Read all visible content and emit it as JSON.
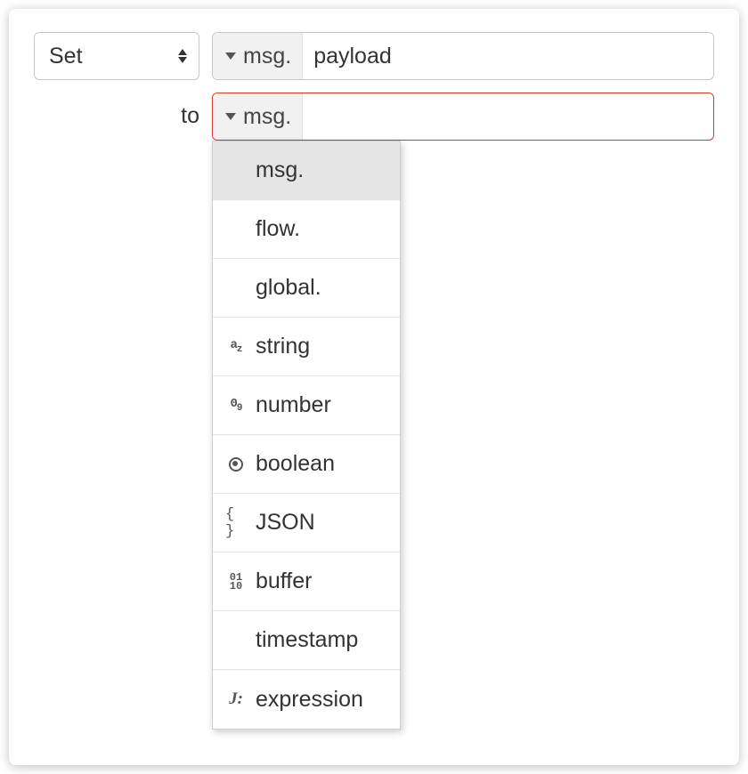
{
  "action_select": {
    "value": "Set"
  },
  "property_input": {
    "type_label": "msg.",
    "value": "payload"
  },
  "to_label": "to",
  "value_input": {
    "type_label": "msg.",
    "value": ""
  },
  "type_dropdown": {
    "options": [
      {
        "label": "msg.",
        "icon": "",
        "selected": true
      },
      {
        "label": "flow.",
        "icon": "",
        "selected": false
      },
      {
        "label": "global.",
        "icon": "",
        "selected": false
      },
      {
        "label": "string",
        "icon": "az",
        "selected": false
      },
      {
        "label": "number",
        "icon": "09",
        "selected": false
      },
      {
        "label": "boolean",
        "icon": "bool",
        "selected": false
      },
      {
        "label": "JSON",
        "icon": "json",
        "selected": false
      },
      {
        "label": "buffer",
        "icon": "bin",
        "selected": false
      },
      {
        "label": "timestamp",
        "icon": "",
        "selected": false
      },
      {
        "label": "expression",
        "icon": "expr",
        "selected": false
      }
    ]
  }
}
